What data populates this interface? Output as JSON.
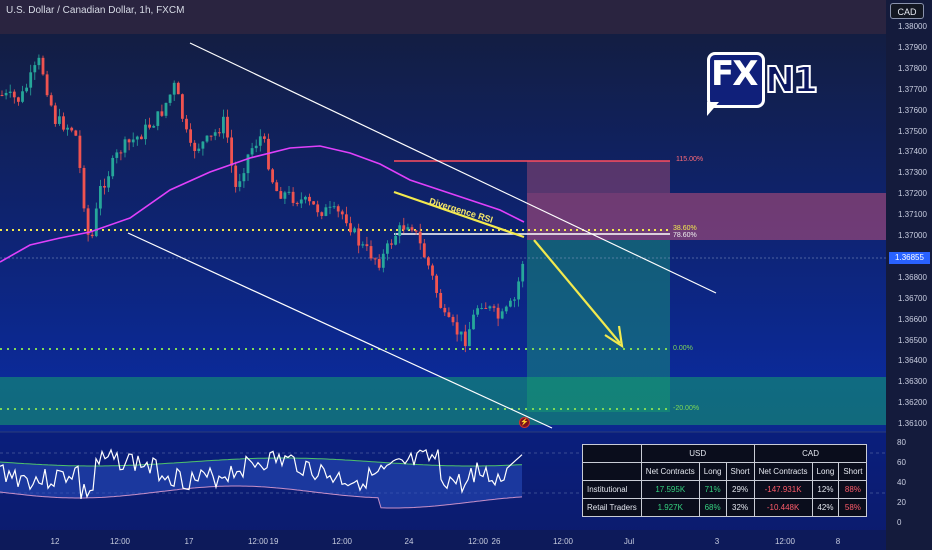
{
  "header": {
    "symbol_title": "U.S. Dollar / Canadian Dollar, 1h, FXCM",
    "currency": "CAD"
  },
  "price_axis": {
    "labels": [
      "1.38000",
      "1.37900",
      "1.37800",
      "1.37700",
      "1.37600",
      "1.37500",
      "1.37400",
      "1.37300",
      "1.37200",
      "1.37100",
      "1.37000",
      "1.36900",
      "1.36800",
      "1.36700",
      "1.36600",
      "1.36500",
      "1.36400",
      "1.36300",
      "1.36200",
      "1.36100"
    ],
    "current_price": "1.36855"
  },
  "time_axis": {
    "labels": [
      "12",
      "12:00",
      "17",
      "12:00",
      "19",
      "12:00",
      "24",
      "12:00",
      "26",
      "12:00",
      "Jul",
      "3",
      "12:00",
      "8"
    ]
  },
  "rsi_axis": {
    "labels": [
      "80",
      "60",
      "40",
      "20",
      "0"
    ]
  },
  "annotations": {
    "divergence_label": "Divergence RSI",
    "fib_115": "115.00%",
    "fib_38": "38.60%",
    "fib_78": "78.60%",
    "fib_0": "0.00%",
    "fib_neg20": "-20.00%"
  },
  "logo": {
    "left": "FX",
    "right": "N1"
  },
  "positions_table": {
    "group_usd": "USD",
    "group_cad": "CAD",
    "headers": [
      "Net Contracts",
      "Long",
      "Short",
      "Net Contracts",
      "Long",
      "Short"
    ],
    "rows": [
      {
        "label": "Institutional",
        "usd_net": "17.595K",
        "usd_long": "71%",
        "usd_short": "29%",
        "cad_net": "-147.931K",
        "cad_long": "12%",
        "cad_short": "88%"
      },
      {
        "label": "Retail Traders",
        "usd_net": "1.927K",
        "usd_long": "68%",
        "usd_short": "32%",
        "cad_net": "-10.448K",
        "cad_long": "42%",
        "cad_short": "58%"
      }
    ]
  },
  "colors": {
    "bull": "#26a69a",
    "bear": "#ef5350",
    "ma": "#e040fb",
    "trend": "#ffffff",
    "fib_yellow": "#f2e94e",
    "fib_green": "#7ed957",
    "stop_zone": "#b04a6a",
    "target_zone": "#1a8c7a"
  },
  "icons": {
    "alert": "lightning-icon"
  }
}
